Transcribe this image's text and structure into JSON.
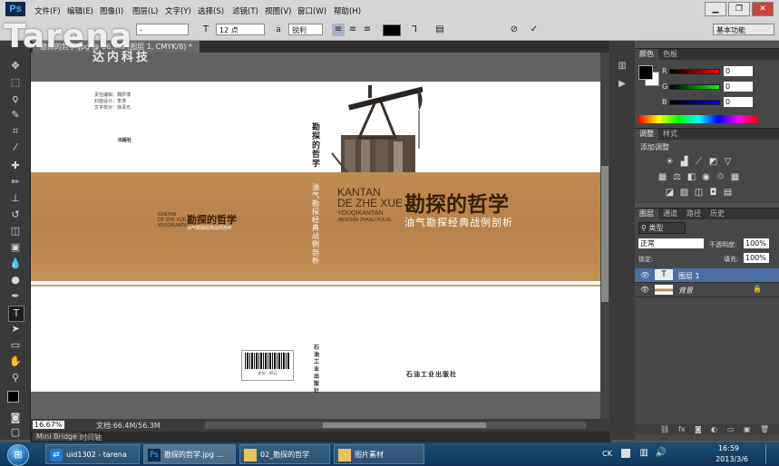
{
  "watermark": {
    "text": "Tarena",
    "subtext": "达内科技"
  },
  "app": {
    "logo": "Ps"
  },
  "menu": [
    "文件(F)",
    "编辑(E)",
    "图像(I)",
    "图层(L)",
    "文字(Y)",
    "选择(S)",
    "滤镜(T)",
    "视图(V)",
    "窗口(W)",
    "帮助(H)"
  ],
  "options": {
    "font_style": "-",
    "font_size": "12 点",
    "antialias": "锐利",
    "workspace": "基本功能"
  },
  "document": {
    "tab_label": "勘探的哲学.jpg @ 16.7% (图层 1, CMYK/8) *",
    "credits": [
      "责任编辑：魏厚博",
      "封面设计：李涛",
      "文字校对：徐泽光"
    ],
    "publisher_small": "出版社",
    "spine_title": "勘探的哲学",
    "spine_subtitle": "油气勘探经典战例剖析",
    "back_pinyin": [
      "KANTAN",
      "DE ZHE XUE",
      "YOUQIKANTAN"
    ],
    "back_title": "勘探的哲学",
    "back_subtitle": "油气勘探经典战例剖析",
    "front_pinyin": [
      "KANTAN",
      "DE ZHE XUE",
      "YOUQIKANTAN"
    ],
    "front_pinyin_small": "JINGDIAN ZHANLI POUXI",
    "front_title": "勘探的哲学",
    "front_subtitle": "油气勘探经典战例剖析",
    "publisher": "石油工业出版社",
    "spine_publisher": "石油工业出版社",
    "barcode_label": "定价：45元"
  },
  "status": {
    "zoom": "16.67%",
    "doc_size": "文档:66.4M/56.3M"
  },
  "bottom_tabs": [
    "Mini Bridge",
    "时间轴"
  ],
  "color_panel": {
    "tabs": [
      "颜色",
      "色板"
    ],
    "channels": [
      {
        "label": "R",
        "value": "0"
      },
      {
        "label": "G",
        "value": "0"
      },
      {
        "label": "B",
        "value": "0"
      }
    ]
  },
  "adjust_panel": {
    "tabs": [
      "调整",
      "样式"
    ],
    "title": "添加调整"
  },
  "layers_panel": {
    "tabs": [
      "图层",
      "通道",
      "路径",
      "历史"
    ],
    "filter": "类型",
    "blend_mode": "正常",
    "opacity_label": "不透明度:",
    "opacity": "100%",
    "lock_label": "锁定:",
    "fill_label": "填充:",
    "fill": "100%",
    "layers": [
      {
        "name": "图层 1",
        "type": "text",
        "selected": true
      },
      {
        "name": "背景",
        "type": "image",
        "locked": true
      }
    ]
  },
  "taskbar": {
    "items": [
      {
        "label": "uid1302 - tarena",
        "icon": "teamviewer-icon"
      },
      {
        "label": "勘探的哲学.jpg ...",
        "icon": "photoshop-icon"
      },
      {
        "label": "02_勘探的哲学",
        "icon": "folder-icon"
      },
      {
        "label": "图片素材",
        "icon": "folder-icon"
      }
    ],
    "time": "16:59",
    "date": "2013/3/6",
    "lang": "CK"
  },
  "colors": {
    "wood": "#b8814a",
    "foreground": "#000000",
    "background": "#ffffff",
    "selection": "#4a6fa5"
  }
}
